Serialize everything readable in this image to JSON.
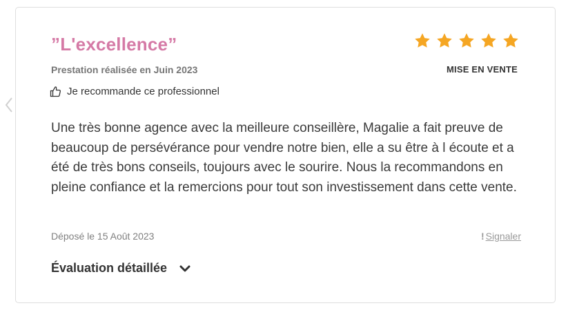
{
  "review": {
    "title": "”L'excellence”",
    "rating": 5,
    "rating_max": 5,
    "prestation": "Prestation réalisée en Juin 2023",
    "category": "MISE EN VENTE",
    "recommendation": "Je recommande ce professionnel",
    "text": "Une très bonne agence avec la meilleure conseillère, Magalie a fait preuve de beaucoup de persévérance pour vendre notre bien, elle a su être à l écoute et a été de très bons conseils, toujours avec le sourire. Nous la recommandons en pleine confiance et la remercions pour tout son investissement dans cette vente.",
    "deposit_date": "Déposé le 15 Août 2023",
    "report_mark": "!",
    "report_label": "Signaler",
    "details_label": "Évaluation détaillée"
  },
  "colors": {
    "title": "#d57aa6",
    "star": "#f5a623",
    "card_border": "#dedede"
  },
  "icons": {
    "prev": "chevron-left-icon",
    "star": "star-icon",
    "recommend": "thumbs-up-icon",
    "details": "chevron-down-icon"
  }
}
